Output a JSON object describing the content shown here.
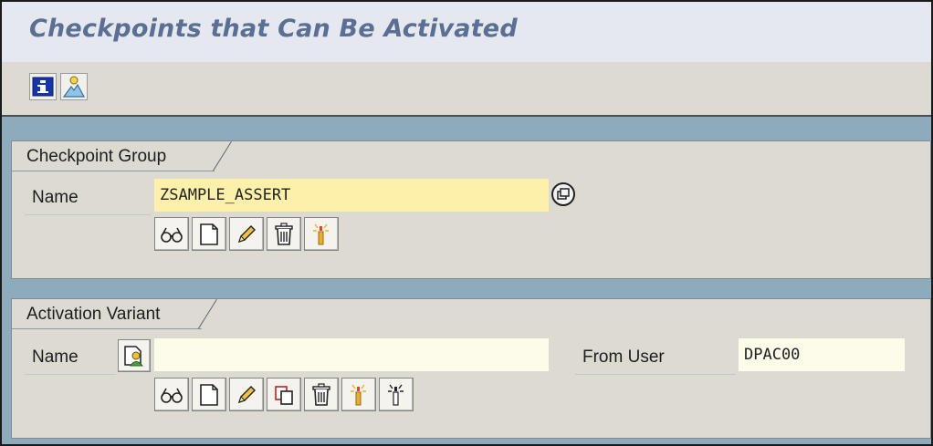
{
  "window": {
    "title": "Checkpoints that Can Be Activated"
  },
  "toolbar": {
    "buttons": [
      {
        "icon": "info-icon",
        "tooltip": ""
      },
      {
        "icon": "user-landscape-icon",
        "tooltip": ""
      }
    ]
  },
  "checkpoint_group": {
    "heading": "Checkpoint Group",
    "name_label": "Name",
    "name_value": "ZSAMPLE_ASSERT",
    "actions": [
      "display-glasses-icon",
      "create-page-icon",
      "change-pencil-icon",
      "delete-trash-icon",
      "activate-icon"
    ]
  },
  "activation_variant": {
    "heading": "Activation Variant",
    "name_label": "Name",
    "name_value": "",
    "from_user_label": "From User",
    "from_user_value": "DPAC00",
    "actions": [
      "display-glasses-icon",
      "create-page-icon",
      "change-pencil-icon",
      "copy-icon",
      "delete-trash-icon",
      "activate-icon",
      "deactivate-icon"
    ]
  },
  "colors": {
    "title_text": "#5a6f93",
    "required_field": "#fdf0aa",
    "panel_bg": "#dcdad1",
    "window_bg": "#8eaabd"
  }
}
